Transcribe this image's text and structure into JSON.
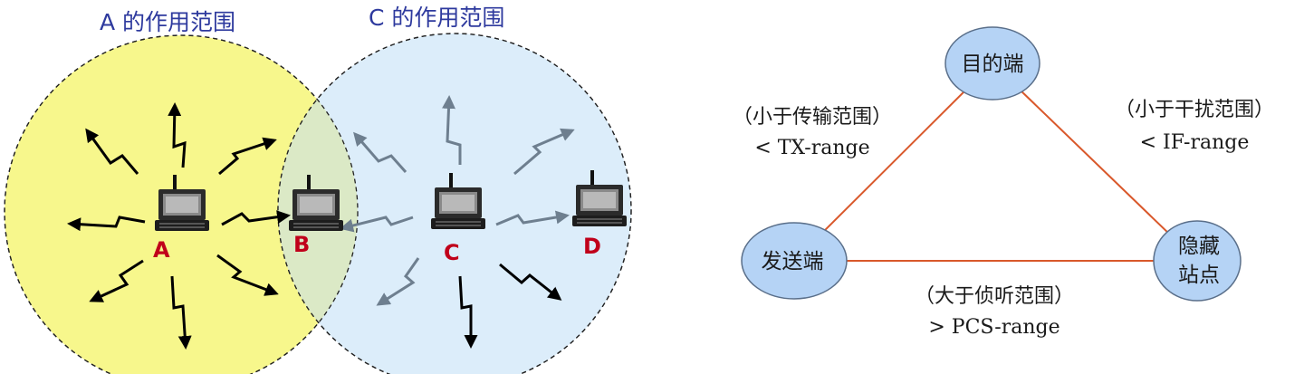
{
  "left_diagram": {
    "range_a_title": "A 的作用范围",
    "range_c_title": "C 的作用范围",
    "stations": [
      {
        "id": "A",
        "label": "A"
      },
      {
        "id": "B",
        "label": "B"
      },
      {
        "id": "C",
        "label": "C"
      },
      {
        "id": "D",
        "label": "D"
      }
    ],
    "colors": {
      "range_a_fill": "#f7f78c",
      "range_c_fill": "#dcedfa",
      "overlap_fill": "#dbe9c6",
      "title_color": "#2e3a9e",
      "station_label_color": "#c0001a",
      "signal_a_color": "#000000",
      "signal_c_color": "#6e7f8f"
    }
  },
  "right_diagram": {
    "nodes": {
      "destination": "目的端",
      "sender": "发送端",
      "hidden_line1": "隐藏",
      "hidden_line2": "站点"
    },
    "edges": {
      "sender_destination_line1": "（小于传输范围）",
      "sender_destination_line2": "< TX-range",
      "destination_hidden_line1": "（小于干扰范围）",
      "destination_hidden_line2": "< IF-range",
      "sender_hidden_line1": "（大于侦听范围）",
      "sender_hidden_line2": "> PCS-range"
    },
    "colors": {
      "node_fill": "#b5d3f5",
      "node_stroke": "#5a6f8a",
      "edge_color": "#d9582b"
    }
  }
}
